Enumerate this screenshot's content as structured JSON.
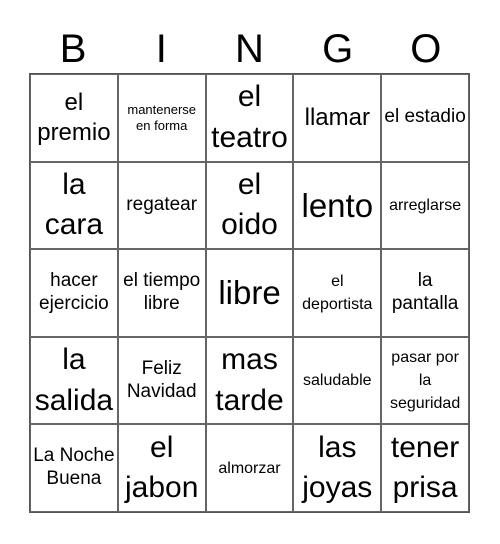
{
  "card": {
    "header": [
      "B",
      "I",
      "N",
      "G",
      "O"
    ],
    "rows": [
      [
        {
          "text": "el premio",
          "size": "lg"
        },
        {
          "text": "mantenerse en forma",
          "size": "xs"
        },
        {
          "text": "el teatro",
          "size": "xl"
        },
        {
          "text": "llamar",
          "size": "lg"
        },
        {
          "text": "el estadio",
          "size": "md"
        }
      ],
      [
        {
          "text": "la cara",
          "size": "xl"
        },
        {
          "text": "regatear",
          "size": "md"
        },
        {
          "text": "el oido",
          "size": "xl"
        },
        {
          "text": "lento",
          "size": "xxl"
        },
        {
          "text": "arreglarse",
          "size": "sm"
        }
      ],
      [
        {
          "text": "hacer ejercicio",
          "size": "md"
        },
        {
          "text": "el tiempo libre",
          "size": "md"
        },
        {
          "text": "libre",
          "size": "xxl"
        },
        {
          "text": "el deportista",
          "size": "sm"
        },
        {
          "text": "la pantalla",
          "size": "md"
        }
      ],
      [
        {
          "text": "la salida",
          "size": "xl"
        },
        {
          "text": "Feliz Navidad",
          "size": "md"
        },
        {
          "text": "mas tarde",
          "size": "xl"
        },
        {
          "text": "saludable",
          "size": "sm"
        },
        {
          "text": "pasar por la seguridad",
          "size": "sm"
        }
      ],
      [
        {
          "text": "La Noche Buena",
          "size": "md"
        },
        {
          "text": "el jabon",
          "size": "xl"
        },
        {
          "text": "almorzar",
          "size": "sm"
        },
        {
          "text": "las joyas",
          "size": "xl"
        },
        {
          "text": "tener prisa",
          "size": "xl"
        }
      ]
    ]
  }
}
